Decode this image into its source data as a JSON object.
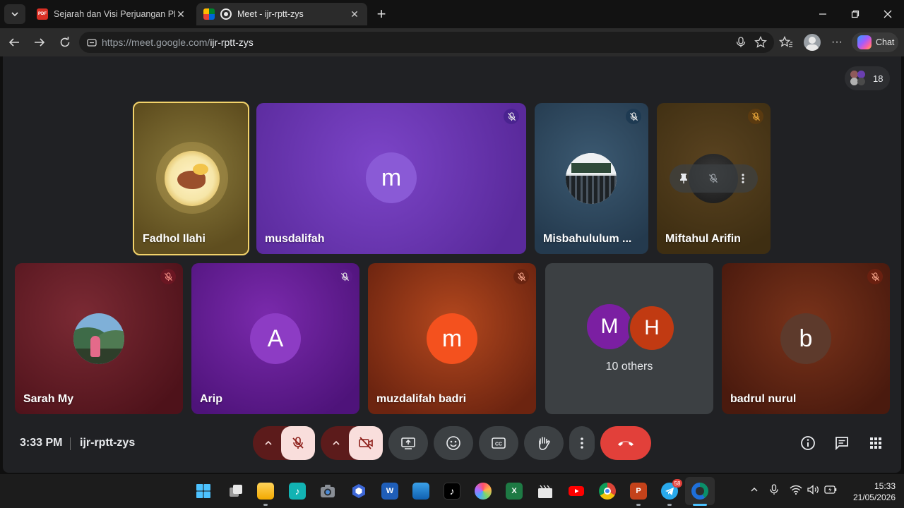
{
  "browser": {
    "tabs": [
      {
        "title": "Sejarah dan Visi Perjuangan PMII.p",
        "favicon": "pdf-icon",
        "active": false
      },
      {
        "title": "Meet - ijr-rptt-zys",
        "favicon": "meet-icon",
        "active": true
      }
    ],
    "url_host": "https://meet.google.com/",
    "url_path": "ijr-rptt-zys",
    "chat_label": "Chat"
  },
  "meet": {
    "participant_count": "18",
    "tiles": [
      {
        "name": "Fadhol Ilahi",
        "avatar": "photo",
        "color": "#6c5a26",
        "speaking": true,
        "muted": false
      },
      {
        "name": "musdalifah",
        "avatar_letter": "m",
        "color": "#6a2fb4",
        "muted": true
      },
      {
        "name": "Misbahululum ...",
        "avatar": "photo",
        "color": "#2b4256",
        "muted": true
      },
      {
        "name": "Miftahul Arifin",
        "avatar": "photo",
        "color": "#4b3816",
        "muted": true,
        "hover_actions": [
          "pin-icon",
          "mute-icon",
          "more-vert-icon"
        ]
      },
      {
        "name": "Sarah My",
        "avatar": "photo",
        "color": "#5e1b25",
        "muted": true
      },
      {
        "name": "Arip",
        "avatar_letter": "A",
        "color": "#5d1a88",
        "muted": true
      },
      {
        "name": "muzdalifah badri",
        "avatar_letter": "m",
        "color": "#8a2e12",
        "muted": true
      },
      {
        "name": "10 others",
        "others_letters": [
          "M",
          "H"
        ],
        "color": "#3c4043",
        "muted": false
      },
      {
        "name": "badrul nurul",
        "avatar_letter": "b",
        "color": "#5b2412",
        "muted": true
      }
    ],
    "time": "3:33 PM",
    "meeting_code": "ijr-rptt-zys",
    "controls": [
      "mic-off-icon",
      "camera-off-icon",
      "present-screen-icon",
      "emoji-icon",
      "captions-icon",
      "raise-hand-icon",
      "more-options-icon",
      "end-call-icon"
    ],
    "right_controls": [
      "info-icon",
      "chat-icon",
      "activities-icon"
    ]
  },
  "taskbar": {
    "apps": [
      "start-icon",
      "task-view-icon",
      "file-explorer-icon",
      "capcut-icon",
      "camera-icon",
      "copilot-icon",
      "word-icon",
      "photos-icon",
      "tiktok-icon",
      "picsart-icon",
      "excel-icon",
      "clapperboard-icon",
      "youtube-icon",
      "chrome-icon",
      "powerpoint-icon",
      "telegram-icon",
      "edge-icon"
    ],
    "telegram_badge": "58",
    "clock_time": "15:33",
    "clock_date": "21/05/2026"
  },
  "colors": {
    "end_call": "#e2403a",
    "mute_pill": "#5c1b1b",
    "mute_inner": "#f9dedc",
    "speaking_border": "#f3d36b"
  }
}
